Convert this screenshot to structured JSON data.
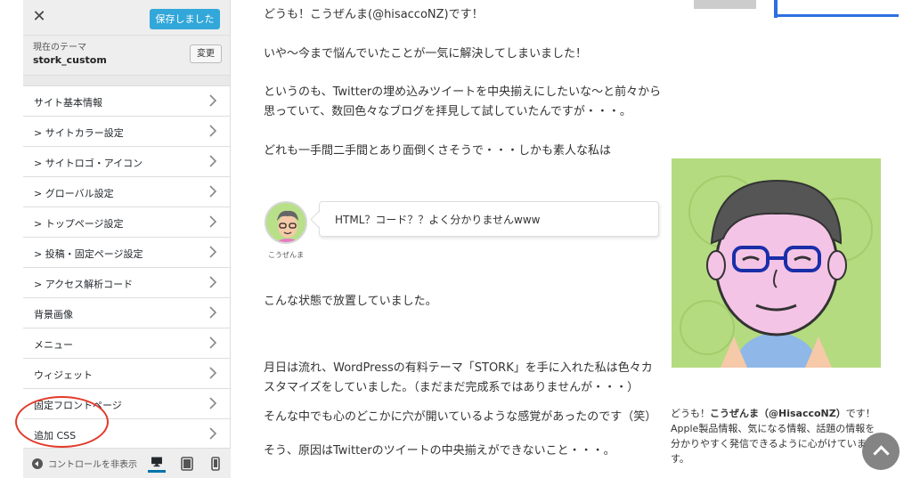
{
  "customizer": {
    "close_label": "✕",
    "save_label": "保存しました",
    "theme_label": "現在のテーマ",
    "theme_name": "stork_custom",
    "change_label": "変更",
    "menu": [
      {
        "label": "サイト基本情報"
      },
      {
        "label": "> サイトカラー設定"
      },
      {
        "label": "> サイトロゴ・アイコン"
      },
      {
        "label": "> グローバル設定"
      },
      {
        "label": "> トップページ設定"
      },
      {
        "label": "> 投稿・固定ページ設定"
      },
      {
        "label": "> アクセス解析コード"
      },
      {
        "label": "背景画像"
      },
      {
        "label": "メニュー"
      },
      {
        "label": "ウィジェット"
      },
      {
        "label": "固定フロントページ"
      },
      {
        "label": "追加 CSS"
      }
    ],
    "footer": {
      "hide_controls_label": "コントロールを非表示"
    },
    "colors": {
      "save_bg": "#32a7d9",
      "active_device": "#0073aa",
      "highlight_circle": "#e23a2a"
    }
  },
  "article": {
    "paragraphs": [
      "どうも！こうぜんま(@hisaccoNZ)です！",
      "いや〜今まで悩んでいたことが一気に解決してしまいました！",
      "というのも、Twitterの埋め込みツイートを中央揃えにしたいな〜と前々から思っていて、数回色々なブログを拝見して試していたんですが・・・。",
      "どれも一手間二手間とあり面倒くさそうで・・・しかも素人な私は",
      "こんな状態で放置していました。",
      "月日は流れ、WordPressの有料テーマ「STORK」を手に入れた私は色々カスタマイズをしていました。（まだまだ完成系ではありませんが・・・）",
      "そんな中でも心のどこかに穴が開いているような感覚があったのです（笑）",
      "そう、原因はTwitterのツイートの中央揃えができないこと・・・。"
    ],
    "chat": {
      "name": "こうぜんま",
      "message": "HTML？コード？？よく分かりませんwww"
    }
  },
  "sidebar": {
    "profile_intro_prefix": "どうも！",
    "profile_name": "こうぜんま（@HisaccoNZ）",
    "profile_intro_suffix": "です！",
    "profile_text": "Apple製品情報、気になる情報、話題の情報を分かりやすく発信できるように心がけています。"
  }
}
